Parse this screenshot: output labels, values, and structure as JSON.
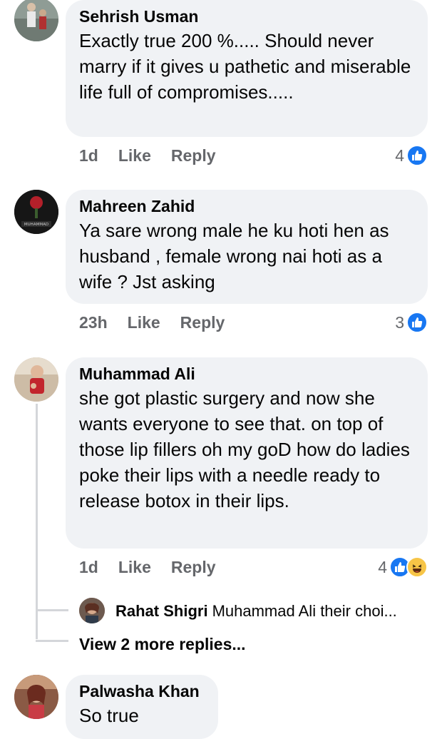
{
  "comments": [
    {
      "author": "Sehrish Usman",
      "text": "Exactly true 200 %..... Should never marry if it gives u pathetic and miserable life full of compromises.....",
      "time": "1d",
      "like_label": "Like",
      "reply_label": "Reply",
      "reaction_count": "4",
      "reactions": [
        "like"
      ]
    },
    {
      "author": "Mahreen Zahid",
      "text": "Ya sare wrong male he ku hoti hen as husband , female wrong nai hoti as a wife ? Jst asking",
      "time": "23h",
      "like_label": "Like",
      "reply_label": "Reply",
      "reaction_count": "3",
      "reactions": [
        "like"
      ],
      "avatar_text": [
        "MUHAMMAD"
      ]
    },
    {
      "author": "Muhammad Ali",
      "text": "she got plastic surgery and now she wants everyone to see that. on top of those lip fillers oh my goD how do ladies poke their lips with a needle ready to release botox in their lips.",
      "time": "1d",
      "like_label": "Like",
      "reply_label": "Reply",
      "reaction_count": "4",
      "reactions": [
        "like",
        "haha"
      ],
      "reply_preview": {
        "author": "Rahat Shigri",
        "text": "Muhammad Ali their choi..."
      },
      "view_more": "View 2 more replies..."
    },
    {
      "author": "Palwasha Khan",
      "text": "So true"
    }
  ],
  "colors": {
    "bubble": "#f0f2f5",
    "meta": "#65676b",
    "like_blue": "#1877f2",
    "haha_yellow": "#f7c547"
  },
  "icons": [
    "like-icon",
    "haha-icon"
  ]
}
